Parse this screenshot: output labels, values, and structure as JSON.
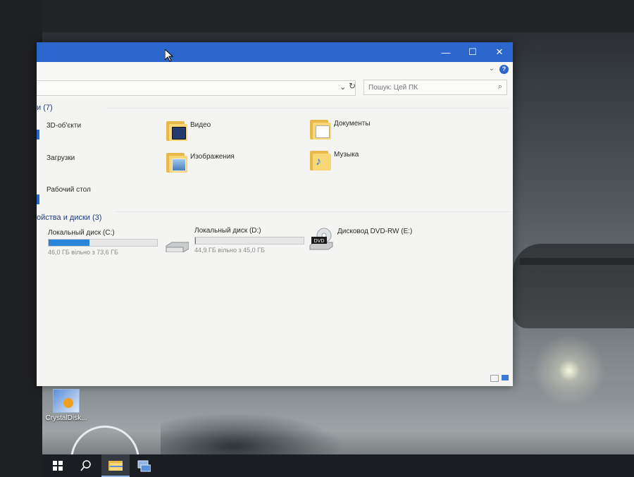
{
  "window": {
    "controls": {
      "minimize": "—",
      "maximize": "☐",
      "close": "✕"
    },
    "address": {
      "dropdown": "⌄",
      "refresh": "↻"
    },
    "search": {
      "placeholder": "Пошук: Цей ПК"
    }
  },
  "sections": {
    "folders": {
      "title": "и",
      "count": "(7)"
    },
    "drives": {
      "title": "ойства и диски",
      "count": "(3)"
    }
  },
  "folders_left": [
    {
      "label": "3D-об'єкти"
    },
    {
      "label": "Загрузки"
    },
    {
      "label": "Рабочий стол"
    }
  ],
  "folders": [
    {
      "label": "Видео",
      "icon": "video-folder-icon"
    },
    {
      "label": "Документы",
      "icon": "documents-folder-icon"
    },
    {
      "label": "Изображения",
      "icon": "pictures-folder-icon"
    },
    {
      "label": "Музыка",
      "icon": "music-folder-icon"
    }
  ],
  "drives": [
    {
      "name": "Локальный диск (C:)",
      "free": "46,0 ГБ вільно з 73,6 ГБ",
      "used_fraction": 0.375
    },
    {
      "name": "Локальный диск (D:)",
      "free": "44,9 ГБ вільно з 45,0 ГБ",
      "used_fraction": 0.002
    },
    {
      "name": "Дисковод DVD-RW (E:)",
      "badge": "DVD"
    }
  ],
  "desktop": {
    "icons": [
      {
        "label": "CrystalDisk..."
      }
    ]
  },
  "colors": {
    "titlebar": "#2b66cc",
    "drive_fill": "#2a84d9",
    "folder": "#f7d776"
  }
}
